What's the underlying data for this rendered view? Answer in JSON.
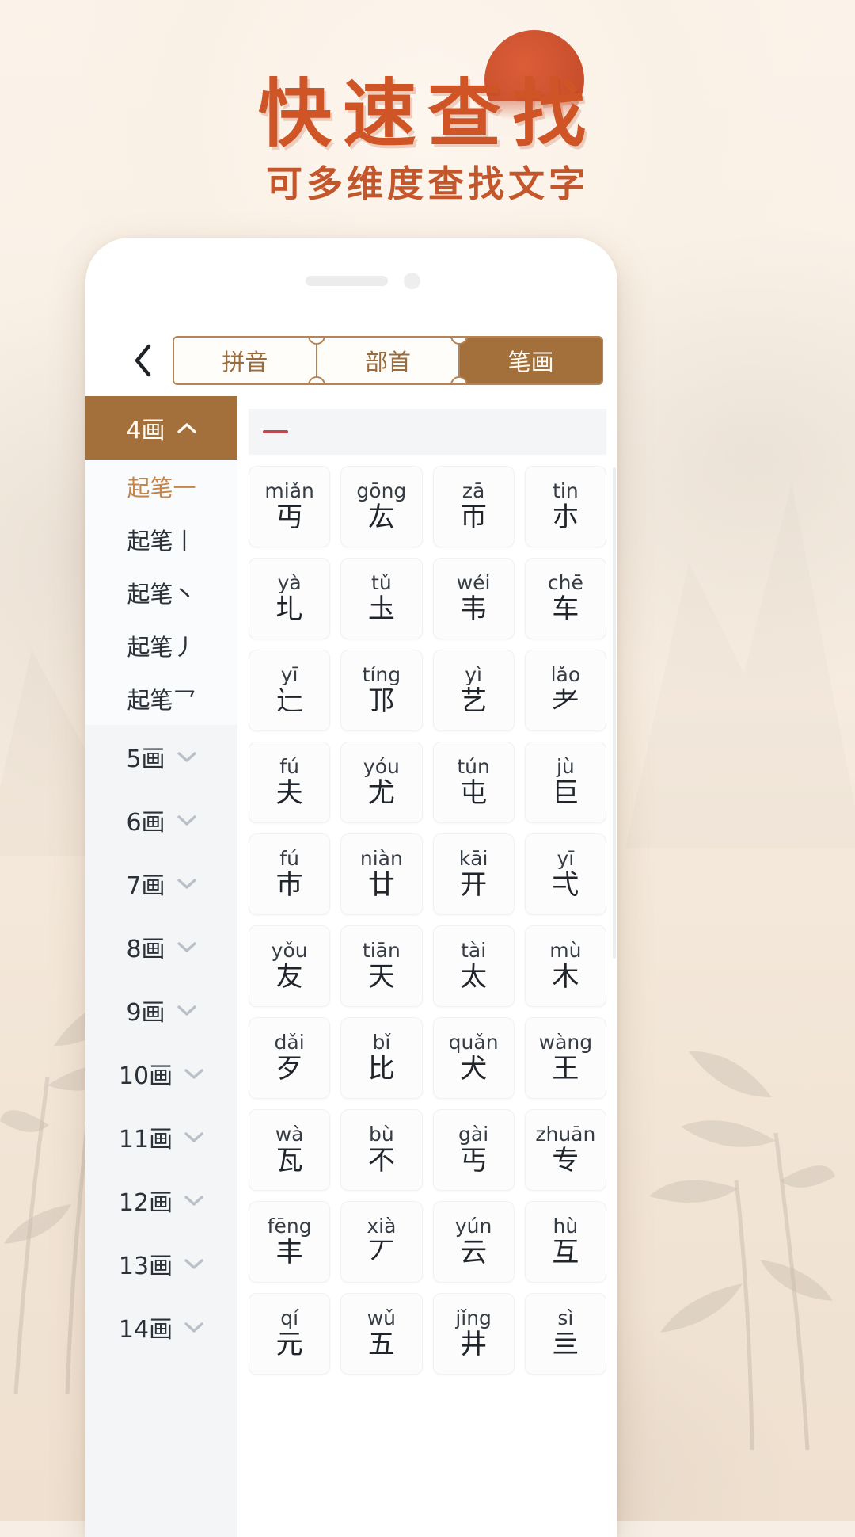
{
  "hero": {
    "title": "快速查找",
    "subtitle": "可多维度查找文字",
    "title_color": "#cf5426",
    "subtitle_color": "#c4562c",
    "sun_color": "#c7441f"
  },
  "phone": {
    "accent_color": "#a3703c",
    "border_color": "#b58354"
  },
  "nav": {
    "back_label": "‹",
    "tabs": [
      {
        "label": "拼音",
        "active": false
      },
      {
        "label": "部首",
        "active": false
      },
      {
        "label": "笔画",
        "active": true
      }
    ]
  },
  "sidebar": {
    "groups": [
      {
        "label": "4画",
        "expanded": true,
        "chevron": "up",
        "items": [
          {
            "label": "起笔一",
            "active": true
          },
          {
            "label": "起笔丨",
            "active": false
          },
          {
            "label": "起笔丶",
            "active": false
          },
          {
            "label": "起笔丿",
            "active": false
          },
          {
            "label": "起笔乛",
            "active": false
          }
        ]
      },
      {
        "label": "5画",
        "expanded": false,
        "chevron": "down",
        "items": []
      },
      {
        "label": "6画",
        "expanded": false,
        "chevron": "down",
        "items": []
      },
      {
        "label": "7画",
        "expanded": false,
        "chevron": "down",
        "items": []
      },
      {
        "label": "8画",
        "expanded": false,
        "chevron": "down",
        "items": []
      },
      {
        "label": "9画",
        "expanded": false,
        "chevron": "down",
        "items": []
      },
      {
        "label": "10画",
        "expanded": false,
        "chevron": "down",
        "items": []
      },
      {
        "label": "11画",
        "expanded": false,
        "chevron": "down",
        "items": []
      },
      {
        "label": "12画",
        "expanded": false,
        "chevron": "down",
        "items": []
      },
      {
        "label": "13画",
        "expanded": false,
        "chevron": "down",
        "items": []
      },
      {
        "label": "14画",
        "expanded": false,
        "chevron": "down",
        "items": []
      }
    ]
  },
  "results": {
    "section_stroke": "一",
    "section_stroke_color": "#c0474f",
    "characters": [
      {
        "pinyin": "miǎn",
        "char": "丏"
      },
      {
        "pinyin": "gōng",
        "char": "厷"
      },
      {
        "pinyin": "zā",
        "char": "帀"
      },
      {
        "pinyin": "tin",
        "char": "朩"
      },
      {
        "pinyin": "yà",
        "char": "圠"
      },
      {
        "pinyin": "tǔ",
        "char": "圡"
      },
      {
        "pinyin": "wéi",
        "char": "韦"
      },
      {
        "pinyin": "chē",
        "char": "车"
      },
      {
        "pinyin": "yī",
        "char": "辷"
      },
      {
        "pinyin": "tíng",
        "char": "邒"
      },
      {
        "pinyin": "yì",
        "char": "艺"
      },
      {
        "pinyin": "lǎo",
        "char": "耂"
      },
      {
        "pinyin": "fú",
        "char": "夫"
      },
      {
        "pinyin": "yóu",
        "char": "尤"
      },
      {
        "pinyin": "tún",
        "char": "屯"
      },
      {
        "pinyin": "jù",
        "char": "巨"
      },
      {
        "pinyin": "fú",
        "char": "巿"
      },
      {
        "pinyin": "niàn",
        "char": "廿"
      },
      {
        "pinyin": "kāi",
        "char": "开"
      },
      {
        "pinyin": "yī",
        "char": "弌"
      },
      {
        "pinyin": "yǒu",
        "char": "友"
      },
      {
        "pinyin": "tiān",
        "char": "天"
      },
      {
        "pinyin": "tài",
        "char": "太"
      },
      {
        "pinyin": "mù",
        "char": "木"
      },
      {
        "pinyin": "dǎi",
        "char": "歹"
      },
      {
        "pinyin": "bǐ",
        "char": "比"
      },
      {
        "pinyin": "quǎn",
        "char": "犬"
      },
      {
        "pinyin": "wàng",
        "char": "王"
      },
      {
        "pinyin": "wà",
        "char": "瓦"
      },
      {
        "pinyin": "bù",
        "char": "不"
      },
      {
        "pinyin": "gài",
        "char": "丐"
      },
      {
        "pinyin": "zhuān",
        "char": "专"
      },
      {
        "pinyin": "fēng",
        "char": "丰"
      },
      {
        "pinyin": "xià",
        "char": "丆"
      },
      {
        "pinyin": "yún",
        "char": "云"
      },
      {
        "pinyin": "hù",
        "char": "互"
      },
      {
        "pinyin": "qí",
        "char": "元"
      },
      {
        "pinyin": "wǔ",
        "char": "五"
      },
      {
        "pinyin": "jǐng",
        "char": "井"
      },
      {
        "pinyin": "sì",
        "char": "亖"
      }
    ]
  }
}
